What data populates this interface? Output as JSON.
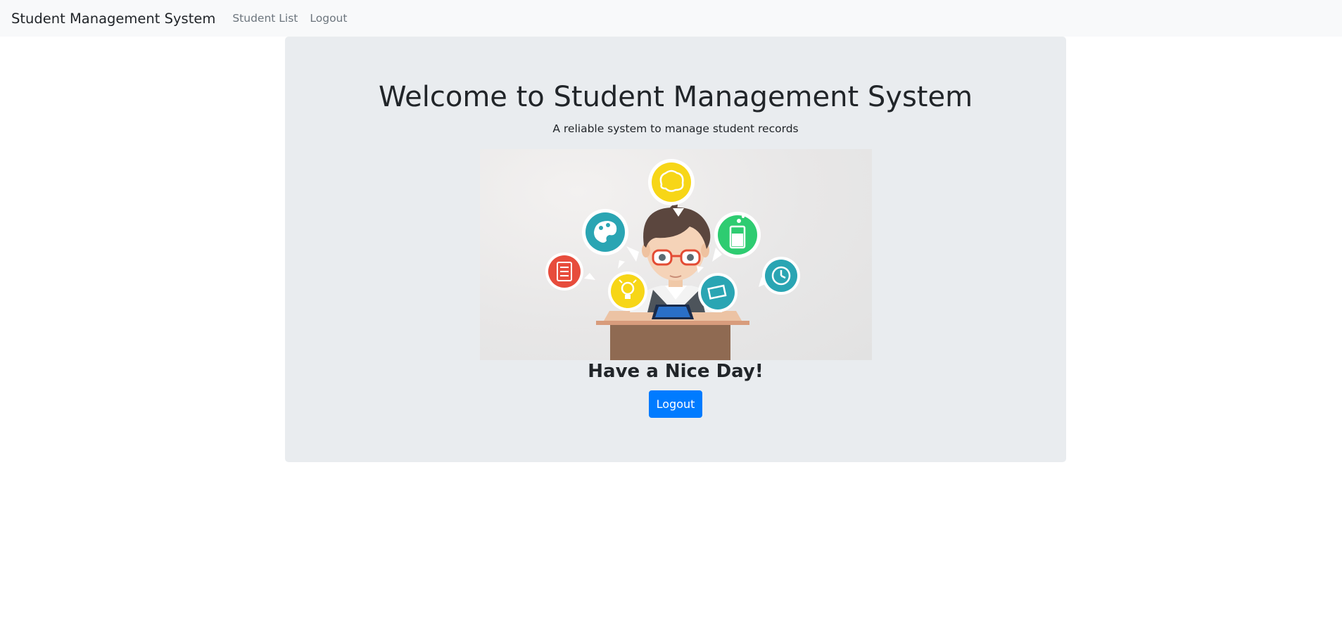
{
  "navbar": {
    "brand": "Student Management System",
    "links": [
      {
        "label": "Student List"
      },
      {
        "label": "Logout"
      }
    ]
  },
  "hero": {
    "title": "Welcome to Student Management System",
    "subtitle": "A reliable system to manage student records",
    "illustration_icons": [
      "brain-icon",
      "palette-icon",
      "beaker-icon",
      "checklist-icon",
      "lightbulb-icon",
      "books-icon",
      "clock-icon"
    ],
    "greeting": "Have a Nice Day!",
    "logout_button": "Logout"
  },
  "colors": {
    "navbar_bg": "#f8f9fa",
    "jumbotron_bg": "#e9ecef",
    "primary_button": "#007bff",
    "icon_yellow": "#f7d617",
    "icon_teal": "#2aa5b3",
    "icon_green": "#2ecc71",
    "icon_red": "#e74c3c"
  }
}
